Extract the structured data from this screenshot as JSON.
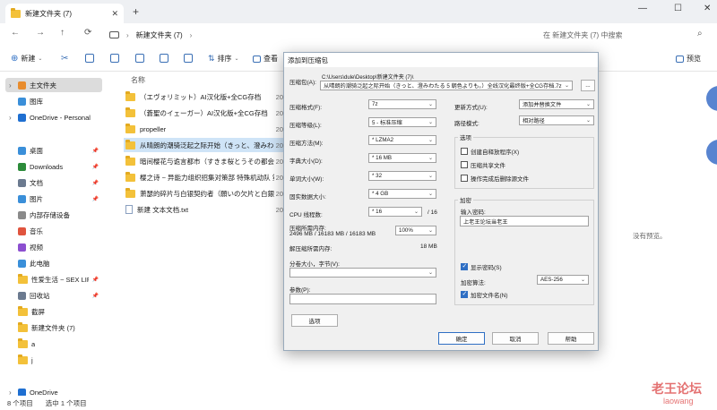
{
  "window": {
    "tab_title": "新建文件夹 (7)",
    "new_tab": "+",
    "minimize": "—",
    "maximize": "☐",
    "close": "✕"
  },
  "nav": {
    "back": "←",
    "forward": "→",
    "up": "↑",
    "refresh": "⟳",
    "breadcrumb": "新建文件夹 (7)",
    "breadcrumb_sep": "›",
    "search_placeholder": "在 新建文件夹 (7) 中搜索"
  },
  "toolbar": {
    "new_label": "新建",
    "sort_label": "排序",
    "view_label": "查看",
    "preview_label": "预览"
  },
  "sidebar": {
    "items": [
      {
        "label": "主文件夹",
        "icon": "home-icon",
        "color": "#e88c2d"
      },
      {
        "label": "图库",
        "icon": "gallery-icon",
        "color": "#3a8fd9"
      },
      {
        "label": "OneDrive - Personal",
        "icon": "cloud-icon",
        "color": "#1f6fd1"
      },
      {
        "label": "桌面",
        "icon": "desktop-icon",
        "color": "#3a8fd9"
      },
      {
        "label": "Downloads",
        "icon": "download-icon",
        "color": "#2c8b3a"
      },
      {
        "label": "文档",
        "icon": "document-icon",
        "color": "#6b7a8f"
      },
      {
        "label": "图片",
        "icon": "picture-icon",
        "color": "#3a8fd9"
      },
      {
        "label": "内部存储设备",
        "icon": "drive-icon",
        "color": "#8a8a8a"
      },
      {
        "label": "音乐",
        "icon": "music-icon",
        "color": "#e0543e"
      },
      {
        "label": "视频",
        "icon": "video-icon",
        "color": "#8c4fd0"
      },
      {
        "label": "此电脑",
        "icon": "computer-icon",
        "color": "#3a8fd9"
      },
      {
        "label": "性爱生活 ~ SEX LIFE (セ·",
        "icon": "folder-icon",
        "color": "#f3c13a"
      },
      {
        "label": "回收站",
        "icon": "recycle-bin-icon",
        "color": "#6b7a8f"
      },
      {
        "label": "截屏",
        "icon": "folder-icon",
        "color": "#f3c13a"
      },
      {
        "label": "新建文件夹 (7)",
        "icon": "folder-icon",
        "color": "#f3c13a"
      },
      {
        "label": "a",
        "icon": "folder-icon",
        "color": "#f3c13a"
      },
      {
        "label": "j",
        "icon": "folder-icon",
        "color": "#f3c13a"
      },
      {
        "label": "OneDrive",
        "icon": "cloud-icon",
        "color": "#1f6fd1"
      }
    ]
  },
  "files": {
    "column_name": "名称",
    "rows": [
      {
        "name": "（エヴォリミット）AI汉化版+全CG存档",
        "date": "20",
        "type": "folder"
      },
      {
        "name": "（蒼聖のイェーガー）AI汉化版+全CG存档",
        "date": "20",
        "type": "folder"
      },
      {
        "name": "propeller",
        "date": "20",
        "type": "folder"
      },
      {
        "name": "从晴朗的潮骑泛起之际开始（きっと、澄みわた",
        "date": "20",
        "type": "folder"
      },
      {
        "name": "暗间樱花与诡言都市（すきま桜とうその都会）",
        "date": "20",
        "type": "folder"
      },
      {
        "name": "樱之诗 ~ 异能力组织招集对策部 特殊机动队 第",
        "date": "20",
        "type": "folder"
      },
      {
        "name": "萧瑟的碎片与白银契约者（願いの欠片と白銀の",
        "date": "20",
        "type": "folder"
      },
      {
        "name": "新建 文本文档.txt",
        "date": "20",
        "type": "text"
      }
    ],
    "preview_empty": "没有预览。"
  },
  "status": {
    "count": "8 个项目",
    "selected": "选中 1 个项目"
  },
  "dialog": {
    "title": "添加到压缩包",
    "archive_label": "压缩包(A):",
    "archive_dir": "C:\\Users\\dule\\Desktop\\新建文件夹 (7)\\",
    "archive_name": "从晴朗的潮骑泛起之际开始（きっと、澄みわたる 5 朝色よりも。）全线汉化最终版+全CG存档.7z",
    "browse": "...",
    "format_label": "压缩格式(F):",
    "format_value": "7z",
    "level_label": "压缩等级(L):",
    "level_value": "5 - 标准压缩",
    "method_label": "压缩方法(M):",
    "method_value": "* LZMA2",
    "dict_label": "字典大小(D):",
    "dict_value": "* 16 MB",
    "word_label": "单词大小(W):",
    "word_value": "* 32",
    "solid_label": "固实数据大小:",
    "solid_value": "* 4 GB",
    "cpu_label": "CPU 线程数:",
    "cpu_value": "* 16",
    "cpu_total": "/ 16",
    "mem_comp_label": "压缩所需内存:",
    "mem_comp_value": "2496 MB / 16183 MB / 16183 MB",
    "mem_percent": "100%",
    "mem_decomp_label": "解压缩所需内存:",
    "mem_decomp_value": "18 MB",
    "split_label": "分卷大小，字节(V):",
    "params_label": "参数(P):",
    "options_button": "选项",
    "update_label": "更新方式(U):",
    "update_value": "添加并替换文件",
    "path_label": "路径模式:",
    "path_value": "相对路径",
    "options_group": "选项",
    "opt_sfx": "创建自释放程序(X)",
    "opt_shared": "压缩共享文件",
    "opt_delete": "操作完成后删除源文件",
    "encrypt_group": "加密",
    "password_label": "输入密码:",
    "password_value": "上老王论坛当老王",
    "show_password": "显示密码(S)",
    "enc_method_label": "加密算法:",
    "enc_method_value": "AES-256",
    "encrypt_names": "加密文件名(N)",
    "ok": "确定",
    "cancel": "取消",
    "help": "帮助"
  },
  "watermark": {
    "line1": "老王论坛",
    "line2": "laowang"
  }
}
